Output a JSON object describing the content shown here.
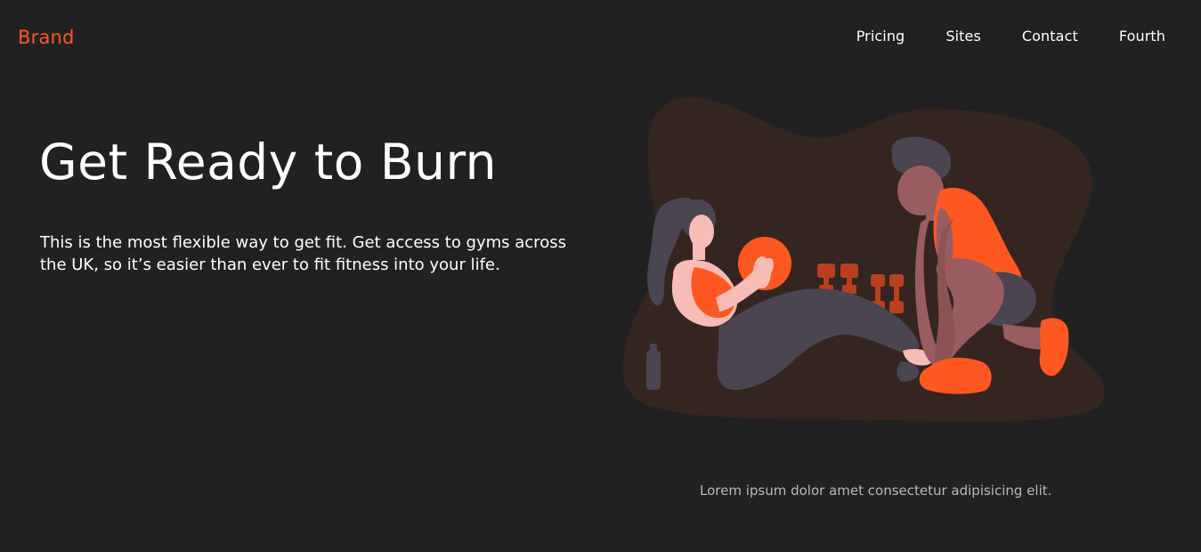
{
  "nav": {
    "brand": "Brand",
    "links": [
      "Pricing",
      "Sites",
      "Contact",
      "Fourth"
    ]
  },
  "hero": {
    "title": "Get Ready to Burn",
    "description": "This is the most flexible way to get fit. Get access to gyms across the UK, so it’s easier than ever to fit fitness into your life."
  },
  "illustration": {
    "name": "fitness-workout-illustration",
    "colors": {
      "blob": "#352520",
      "accent": "#ff5722",
      "dumbbell": "#b8401e",
      "skin_light": "#f7bcb6",
      "skin_dark": "#9a5d5f",
      "clothing": "#4a4550",
      "hair": "#4a4550"
    }
  },
  "caption": "Lorem ipsum dolor amet consectetur adipisicing elit.",
  "colors": {
    "background": "#212121",
    "brand": "#ff5722",
    "text": "#ffffff",
    "muted": "#b8b8b8"
  }
}
